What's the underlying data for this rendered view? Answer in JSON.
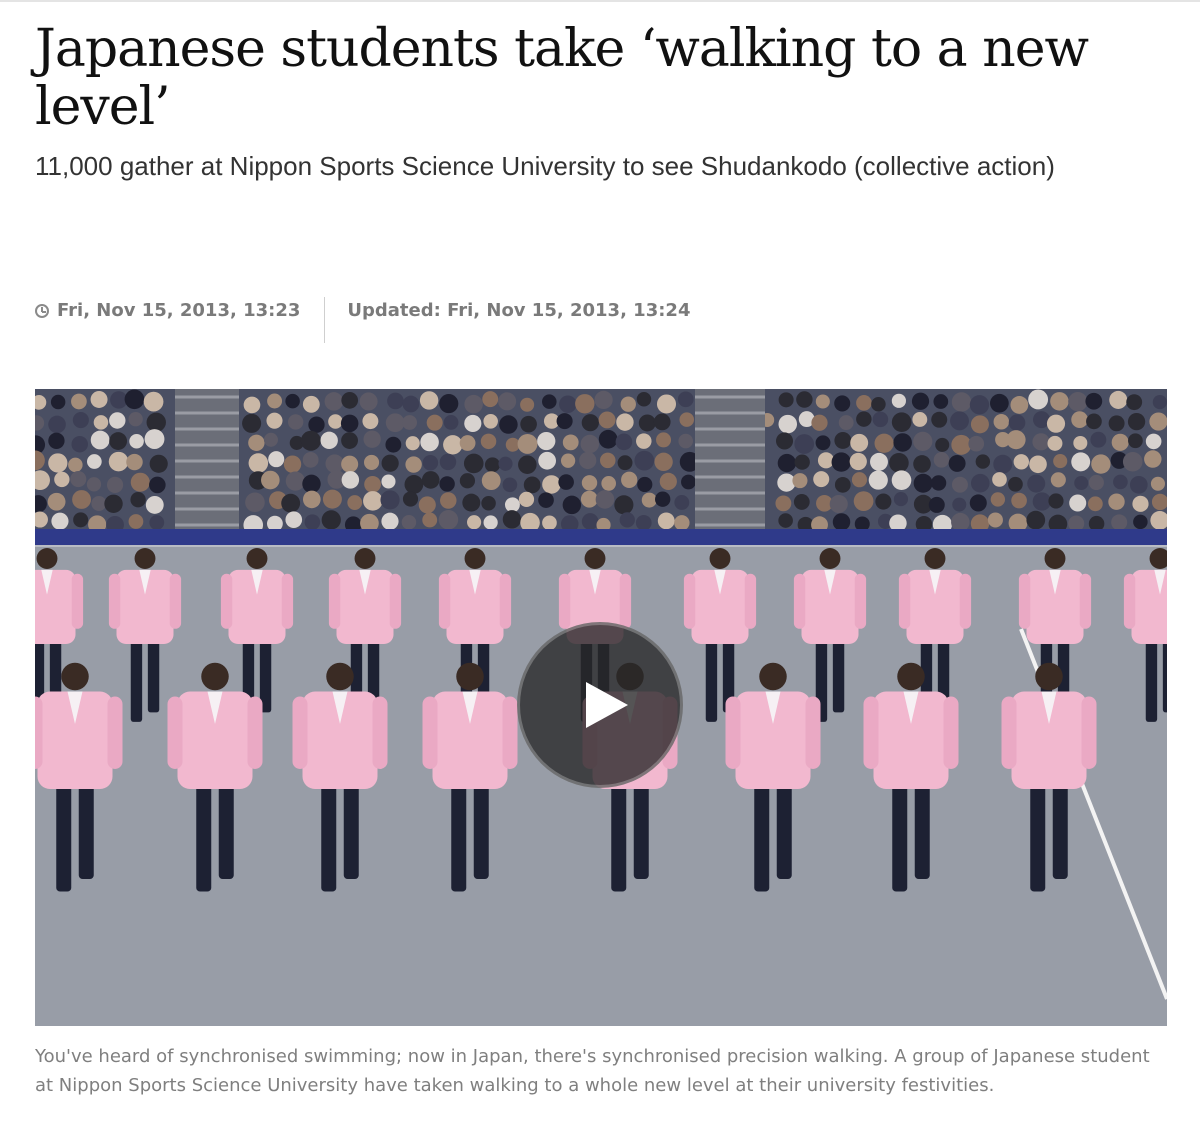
{
  "article": {
    "headline": "Japanese students take ‘walking to a new level’",
    "standfirst": "11,000 gather at Nippon Sports Science University to see Shudankodo (collective action)",
    "published": "Fri, Nov 15, 2013, 13:23",
    "updated": "Updated: Fri, Nov 15, 2013, 13:24",
    "video": {
      "play_icon": "play-icon"
    },
    "caption": "You've heard of synchronised swimming; now in Japan, there's synchronised precision walking. A group of Japanese student at Nippon Sports Science University have taken walking to a whole new level at their university festivities."
  },
  "colors": {
    "headline": "#111111",
    "meta": "#7a7a7a",
    "caption": "#7f7f7f",
    "jacket": "#f2b8cf",
    "floor": "#8e939d"
  }
}
